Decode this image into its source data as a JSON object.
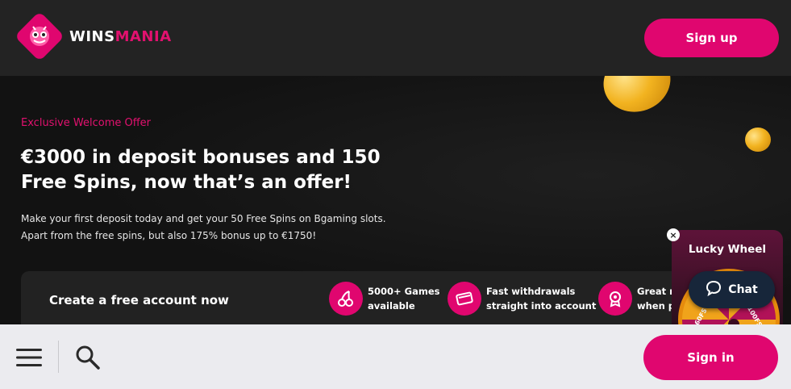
{
  "brand": {
    "wins": "WINS",
    "mania": "MANIA",
    "accent": "#e0066f"
  },
  "header": {
    "signup_label": "Sign up"
  },
  "hero": {
    "kicker": "Exclusive Welcome Offer",
    "title": "€3000 in deposit bonuses and 150 Free Spins, now that’s an offer!",
    "description": "Make your first deposit today and get your 50 Free Spins on Bgaming slots. Apart from the free spins, but also 175% bonus up to €1750!"
  },
  "account_bar": {
    "label": "Create a free account now",
    "features": [
      {
        "icon": "cherries-icon",
        "line1": "5000+ Games",
        "line2": "available"
      },
      {
        "icon": "card-icon",
        "line1": "Fast withdrawals",
        "line2": "straight into account"
      },
      {
        "icon": "medal-icon",
        "line1": "Great r",
        "line2": "when p"
      }
    ]
  },
  "lucky_wheel": {
    "title": "Lucky Wheel",
    "segments": [
      "60FS",
      "100FS"
    ]
  },
  "chat": {
    "label": "Chat"
  },
  "bottom_bar": {
    "signin_label": "Sign in"
  }
}
